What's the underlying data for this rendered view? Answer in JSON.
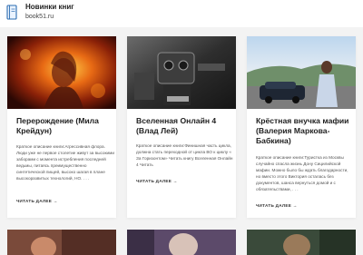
{
  "header": {
    "title": "Новинки книг",
    "url": "book51.ru",
    "logo_icon": "book-icon"
  },
  "cards": [
    {
      "title": "Перерождение (Мила Крейдун)",
      "excerpt": "Краткое описание книги:Агрессивная флора. Люди уже не первое столетие живут за высокими заборами с момента истребления последней ведьмы, питаясь преимущественно синтетической пищей, высоко шагая в плане высокоразвитых технологий, НО. . . .",
      "more": "ЧИТАТЬ ДАЛЕЕ →"
    },
    {
      "title": "Вселенная Онлайн 4 (Влад Лей)",
      "excerpt": "Краткое описание книги:Финишная часть цикла, должна стать переходной от цикла ВО к циклу « За Горизонтом» Читать книгу Вселенная Онлайн 4 Читать",
      "more": "ЧИТАТЬ ДАЛЕЕ →"
    },
    {
      "title": "Крёстная внучка мафии (Валерия Маркова-Бабкина)",
      "excerpt": "Краткое описание книги:Туристка из Москвы случайно спасла жизнь Дону Сицилийской мафии. Можно было бы ждать благодарности, но вместо этого Виктория осталась без документов, шанса вернуться домой и с обязательствами, . . .",
      "more": "ЧИТАТЬ ДАЛЕЕ →"
    }
  ],
  "colors": {
    "background": "#f3f3f3",
    "card": "#ffffff",
    "title": "#1e1e1e",
    "text": "#555555"
  }
}
